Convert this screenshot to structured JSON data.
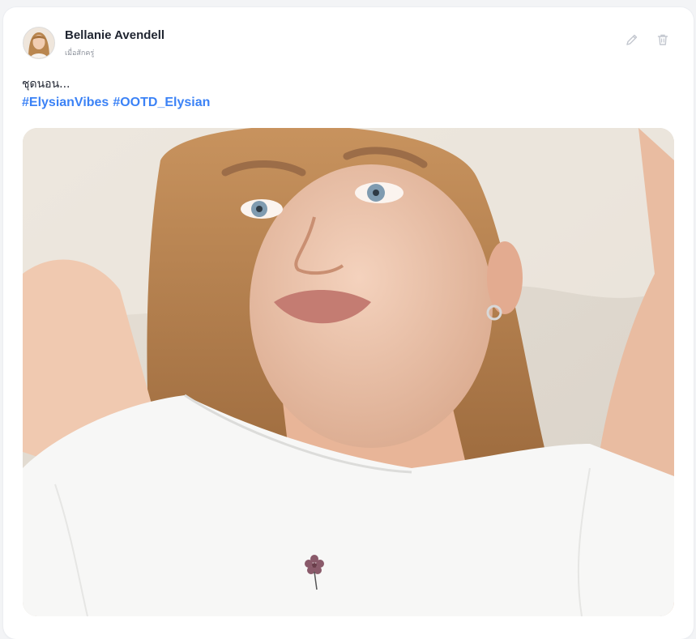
{
  "post": {
    "author": "Bellanie Avendell",
    "timestamp": "เมื่อสักครู่",
    "caption": "ชุดนอน...",
    "hashtags": [
      "#ElysianVibes",
      "#OOTD_Elysian"
    ],
    "image_subject": "portrait-photo"
  },
  "actions": {
    "edit_icon": "pencil-icon",
    "delete_icon": "trash-icon"
  },
  "colors": {
    "hashtag": "#3b82f6",
    "text": "#1f2430",
    "muted": "#8a8f99",
    "icon": "#c3c7cf"
  }
}
